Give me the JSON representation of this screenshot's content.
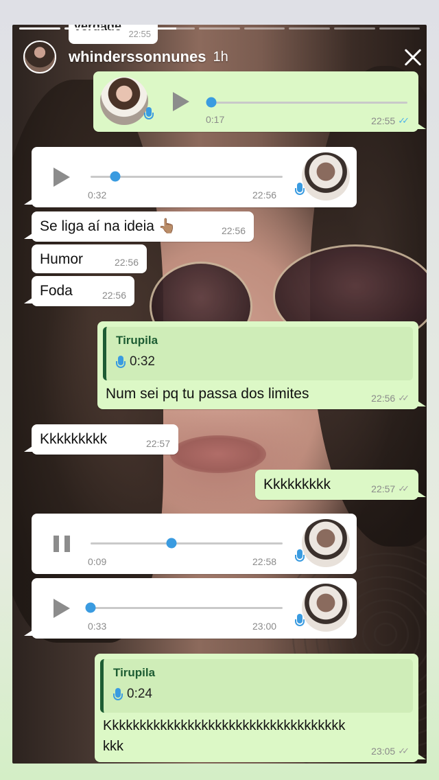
{
  "story": {
    "username": "whinderssonnunes",
    "time_ago": "1h",
    "progress": [
      1,
      1,
      1,
      0.55,
      0,
      0,
      0,
      0,
      0
    ]
  },
  "cutoff_bubble": {
    "text": "verdade",
    "time": "22:55"
  },
  "messages": [
    {
      "type": "voice",
      "direction": "out",
      "state": "play",
      "duration": "0:17",
      "time": "22:55",
      "status": "read",
      "progress": 0.0
    },
    {
      "type": "voice",
      "direction": "in",
      "state": "play",
      "duration": "0:32",
      "time": "22:56",
      "progress": 0.13
    },
    {
      "type": "text",
      "direction": "in",
      "text": "Se liga aí na ideia 👆🏽",
      "time": "22:56"
    },
    {
      "type": "text",
      "direction": "in",
      "text": "Humor",
      "time": "22:56"
    },
    {
      "type": "text",
      "direction": "in",
      "text": "Foda",
      "time": "22:56"
    },
    {
      "type": "reply",
      "direction": "out",
      "quote_name": "Tirupila",
      "quote_duration": "0:32",
      "text": "Num sei pq tu passa dos limites",
      "time": "22:56",
      "status": "sent"
    },
    {
      "type": "text",
      "direction": "in",
      "text": "Kkkkkkkkk",
      "time": "22:57"
    },
    {
      "type": "text",
      "direction": "out",
      "text": "Kkkkkkkkk",
      "time": "22:57",
      "status": "sent"
    },
    {
      "type": "voice",
      "direction": "in",
      "state": "pause",
      "duration": "0:09",
      "time": "22:58",
      "progress": 0.42
    },
    {
      "type": "voice",
      "direction": "in",
      "state": "play",
      "duration": "0:33",
      "time": "23:00",
      "progress": 0.0
    },
    {
      "type": "reply",
      "direction": "out",
      "quote_name": "Tirupila",
      "quote_duration": "0:24",
      "text_line1": "Kkkkkkkkkkkkkkkkkkkkkkkkkkkkkkkkkkk",
      "text_line2": "kkk",
      "time": "23:05",
      "status": "sent"
    }
  ],
  "colors": {
    "incoming": "#ffffff",
    "outgoing": "#dcf8c6",
    "accent": "#3a9be0",
    "quote_bar": "#1d5c33"
  }
}
